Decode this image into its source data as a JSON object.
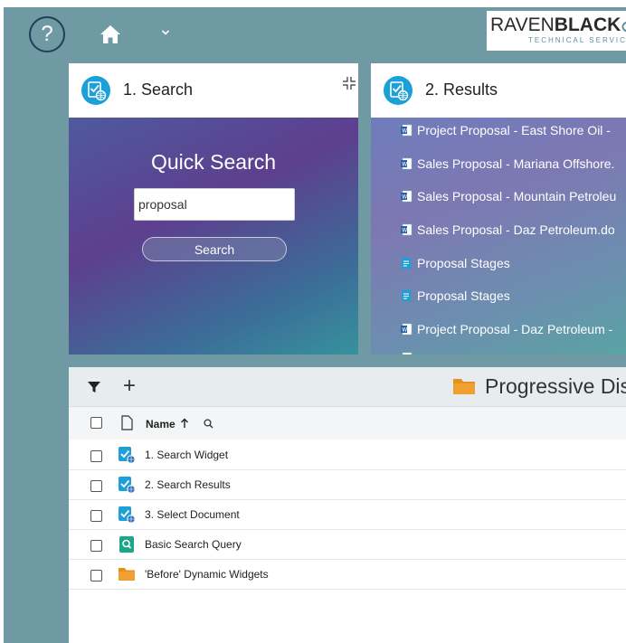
{
  "topbar": {
    "help_label": "?",
    "logo_part1": "RAVEN",
    "logo_part2": "BLACK",
    "logo_sub": "TECHNICAL SERVICES"
  },
  "search_widget": {
    "title": "1. Search",
    "heading": "Quick Search",
    "input_value": "proposal",
    "button_label": "Search"
  },
  "results_widget": {
    "title": "2. Results",
    "items": [
      {
        "label": "Project Proposal - East Shore Oil -",
        "icon": "word-doc-icon"
      },
      {
        "label": "Sales Proposal - Mariana Offshore.",
        "icon": "word-doc-icon"
      },
      {
        "label": "Sales Proposal - Mountain Petroleu",
        "icon": "word-doc-icon"
      },
      {
        "label": "Sales Proposal - Daz Petroleum.do",
        "icon": "word-doc-icon"
      },
      {
        "label": "Proposal Stages",
        "icon": "doc-icon"
      },
      {
        "label": "Proposal Stages",
        "icon": "doc-icon"
      },
      {
        "label": "Project Proposal - Daz Petroleum -",
        "icon": "word-doc-icon"
      }
    ]
  },
  "list_panel": {
    "folder_title": "Progressive Disp",
    "column_name": "Name",
    "rows": [
      {
        "label": "1. Search Widget",
        "icon": "widget-icon"
      },
      {
        "label": "2. Search Results",
        "icon": "widget-icon"
      },
      {
        "label": "3. Select Document",
        "icon": "widget-icon"
      },
      {
        "label": "Basic Search Query",
        "icon": "search-query-icon"
      },
      {
        "label": "'Before' Dynamic Widgets",
        "icon": "folder-icon"
      }
    ]
  },
  "colors": {
    "background": "#6f9aa4",
    "accent_blue": "#1d9fd8",
    "folder_orange": "#e8901a",
    "search_green": "#1aa68a"
  }
}
